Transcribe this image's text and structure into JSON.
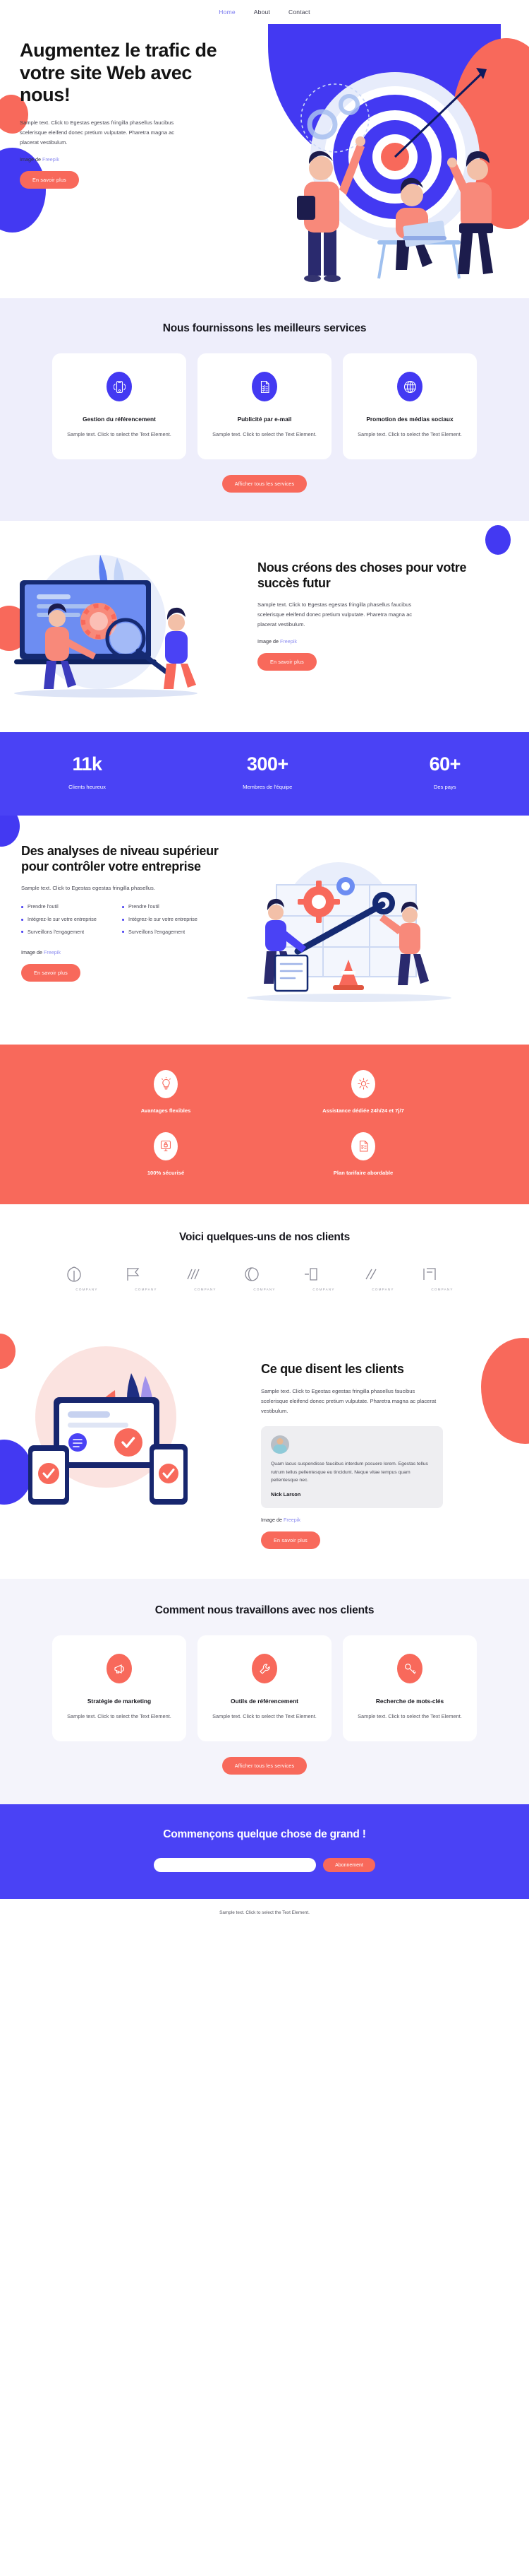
{
  "nav": {
    "items": [
      {
        "label": "Home",
        "active": true
      },
      {
        "label": "About",
        "active": false
      },
      {
        "label": "Contact",
        "active": false
      }
    ]
  },
  "hero": {
    "title": "Augmentez le trafic de votre site Web avec nous!",
    "body": "Sample text. Click to Egestas egestas fringilla phasellus faucibus scelerisque eleifend donec pretium vulputate. Pharetra magna ac placerat vestibulum.",
    "credit_prefix": "Image de ",
    "credit_link": "Freepik",
    "button": "En savoir plus"
  },
  "services": {
    "title": "Nous fournissons les meilleurs services",
    "cards": [
      {
        "icon": "mobile-signal-icon",
        "title": "Gestion du référencement",
        "text": "Sample text. Click to select the Text Element."
      },
      {
        "icon": "checklist-document-icon",
        "title": "Publicité par e-mail",
        "text": "Sample text. Click to select the Text Element."
      },
      {
        "icon": "globe-icon",
        "title": "Promotion des médias sociaux",
        "text": "Sample text. Click to select the Text Element."
      }
    ],
    "button": "Afficher tous les services"
  },
  "create": {
    "title": "Nous créons des choses pour votre succès futur",
    "body": "Sample text. Click to Egestas egestas fringilla phasellus faucibus scelerisque eleifend donec pretium vulputate. Pharetra magna ac placerat vestibulum.",
    "credit_prefix": "Image de ",
    "credit_link": "Freepik",
    "button": "En savoir plus"
  },
  "stats": [
    {
      "value": "11k",
      "label": "Clients heureux"
    },
    {
      "value": "300+",
      "label": "Membres de l'équipe"
    },
    {
      "value": "60+",
      "label": "Des pays"
    }
  ],
  "analytics": {
    "title": "Des analyses de niveau supérieur pour contrôler votre entreprise",
    "body": "Sample text. Click to Egestas egestas fringilla phasellus.",
    "bullets_left": [
      "Prendre l'outil",
      "Intégrez-le sur votre entreprise",
      "Surveillons l'engagement"
    ],
    "bullets_right": [
      "Prendre l'outil",
      "Intégrez-le sur votre entreprise",
      "Surveillons l'engagement"
    ],
    "credit_prefix": "Image de ",
    "credit_link": "Freepik",
    "button": "En savoir plus"
  },
  "features": [
    {
      "icon": "lightbulb-icon",
      "label": "Avantages flexibles"
    },
    {
      "icon": "gear-icon",
      "label": "Assistance dédiée 24h/24 et 7j/7"
    },
    {
      "icon": "lock-screen-icon",
      "label": "100% sécurisé"
    },
    {
      "icon": "checklist-icon",
      "label": "Plan tarifaire abordable"
    }
  ],
  "clients": {
    "title": "Voici quelques-uns de nos clients",
    "logos": [
      {
        "mark": "leaf-mark",
        "name": "COMPANY"
      },
      {
        "mark": "flag-mark",
        "name": "COMPANY"
      },
      {
        "mark": "lines-mark",
        "name": "COMPANY"
      },
      {
        "mark": "swirl-mark",
        "name": "COMPANY"
      },
      {
        "mark": "bracket-mark",
        "name": "COMPANY"
      },
      {
        "mark": "slash-mark",
        "name": "COMPANY"
      },
      {
        "mark": "corner-mark",
        "name": "COMPANY"
      }
    ]
  },
  "testimonials": {
    "title": "Ce que disent les clients",
    "body": "Sample text. Click to Egestas egestas fringilla phasellus faucibus scelerisque eleifend donec pretium vulputate. Pharetra magna ac placerat vestibulum.",
    "quote": "Quam lacus suspendisse faucibus interdum posuere lorem. Egestas tellus rutrum tellus pellentesque eu tincidunt. Neque vitae tempus quam pellentesque nec.",
    "author": "Nick Larson",
    "credit_prefix": "Image de ",
    "credit_link": "Freepik",
    "button": "En savoir plus"
  },
  "process": {
    "title": "Comment nous travaillons avec nos clients",
    "cards": [
      {
        "icon": "megaphone-icon",
        "title": "Stratégie de marketing",
        "text": "Sample text. Click to select the Text Element."
      },
      {
        "icon": "wrench-icon",
        "title": "Outils de référencement",
        "text": "Sample text. Click to select the Text Element."
      },
      {
        "icon": "key-icon",
        "title": "Recherche de mots-clés",
        "text": "Sample text. Click to select the Text Element."
      }
    ],
    "button": "Afficher tous les services"
  },
  "cta": {
    "title": "Commençons quelque chose de grand !",
    "input_placeholder": "",
    "input_value": "",
    "button": "Abonnement"
  },
  "footer": {
    "text": "Sample text. Click to select the Text Element."
  },
  "colors": {
    "blue": "#4339f2",
    "coral": "#f8695b",
    "light_lavender": "#eeeefb",
    "stats_blue": "#4a42f5"
  }
}
